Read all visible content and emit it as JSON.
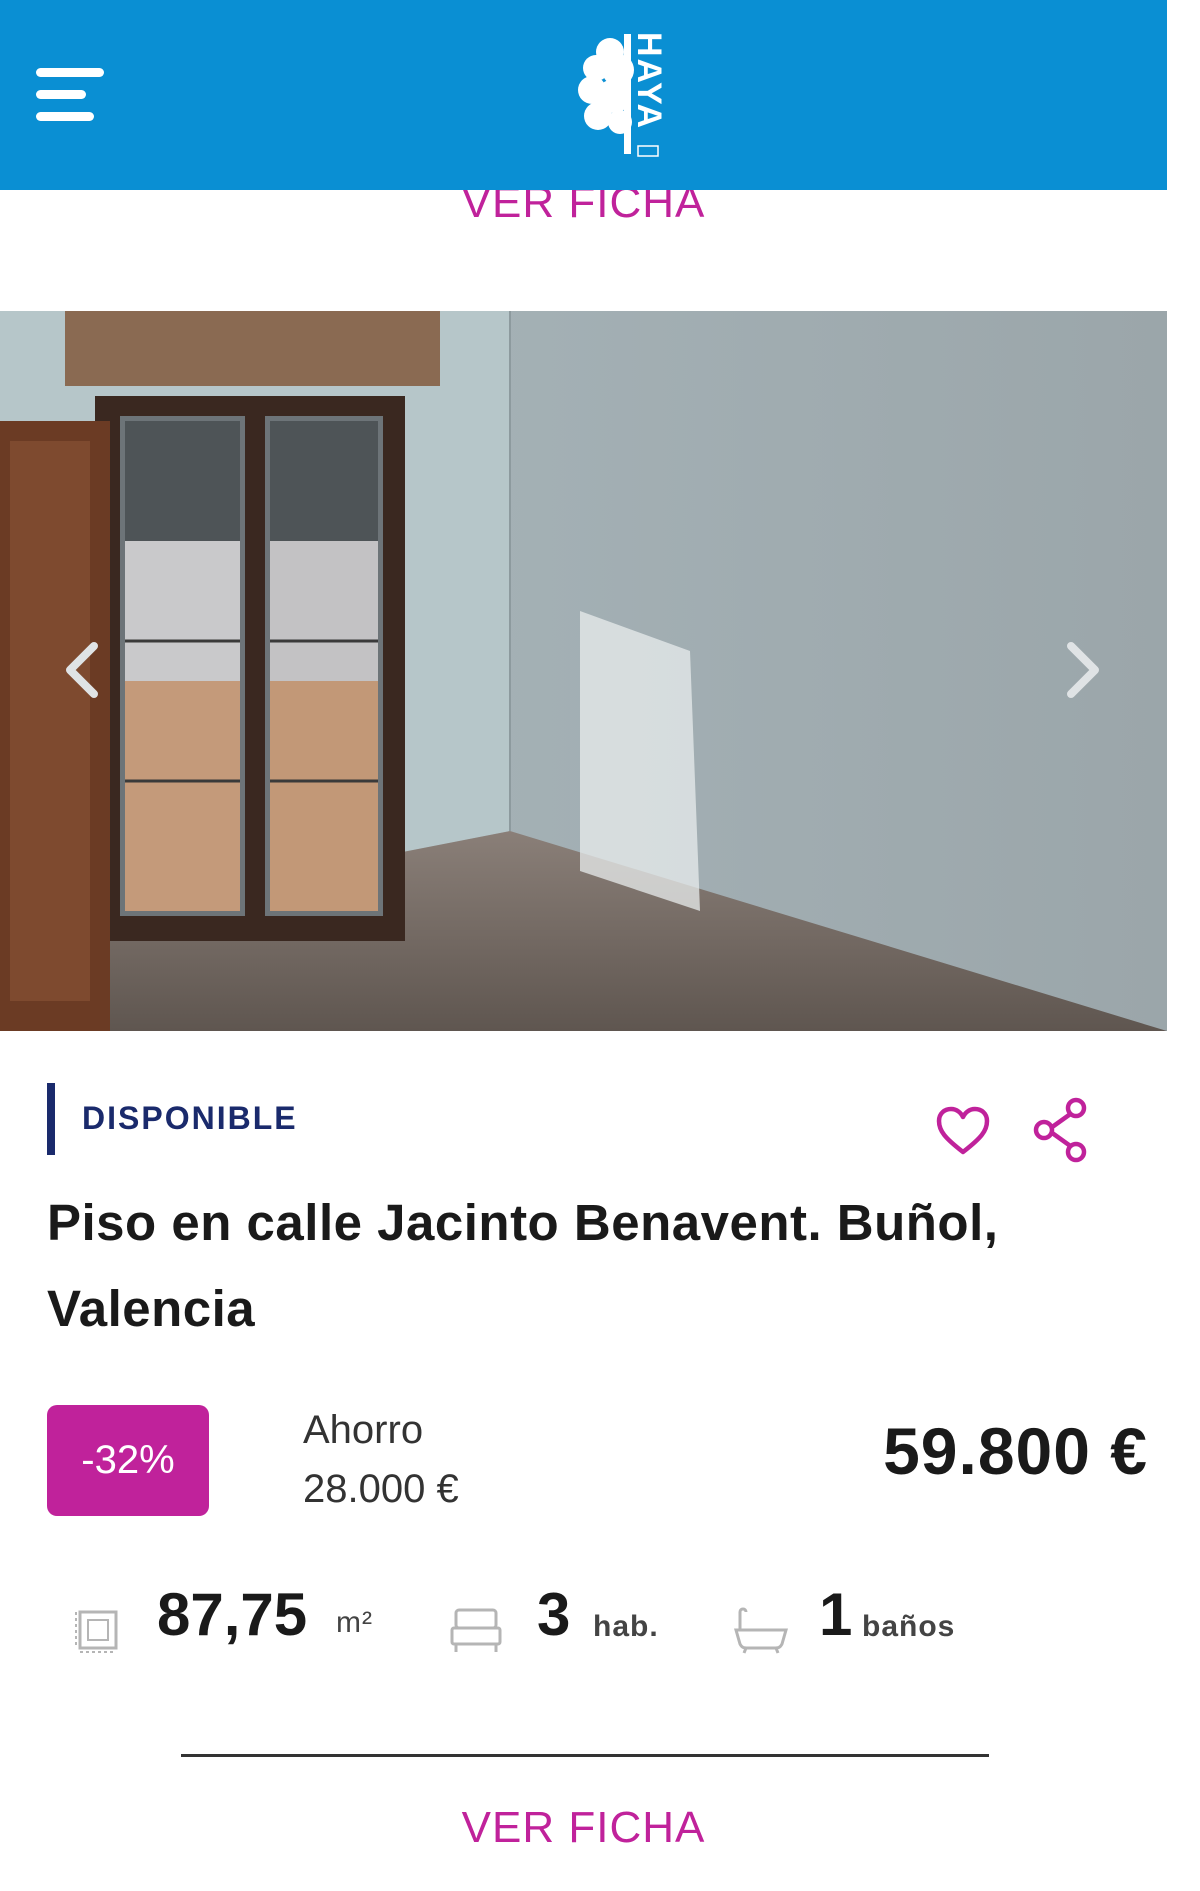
{
  "header": {
    "brand": "HAYA",
    "colors": {
      "background": "#0a8fd3",
      "accent": "#c0229b",
      "status": "#1a2a6c"
    }
  },
  "previous_card": {
    "link_label": "VER FICHA"
  },
  "listing": {
    "photo": {
      "prev_icon": "chevron-left-icon",
      "next_icon": "chevron-right-icon"
    },
    "status": "DISPONIBLE",
    "favorite_icon": "heart-icon",
    "share_icon": "share-icon",
    "title": "Piso en calle Jacinto Benavent. Buñol, Valencia",
    "discount": "-32%",
    "saving_label": "Ahorro",
    "saving_value": "28.000 €",
    "price": "59.800 €",
    "features": {
      "area": {
        "value": "87,75",
        "unit": "m²",
        "icon": "floor-plan-icon"
      },
      "rooms": {
        "value": "3",
        "unit": "hab.",
        "icon": "bed-icon"
      },
      "baths": {
        "value": "1",
        "unit": "baños",
        "icon": "bathtub-icon"
      }
    },
    "link_label": "VER FICHA"
  }
}
